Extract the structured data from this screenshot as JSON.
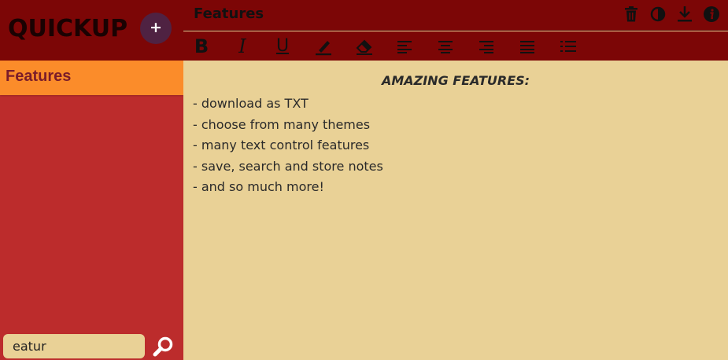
{
  "app": {
    "logo": "QUICKUP",
    "add_label": "+"
  },
  "sidebar": {
    "notes": [
      {
        "label": "Features"
      }
    ],
    "search": {
      "value": "eatur",
      "placeholder": ""
    }
  },
  "header": {
    "title": "Features"
  },
  "toolbar": {
    "actions": [
      "trash-icon",
      "theme-contrast-icon",
      "download-icon",
      "info-icon"
    ],
    "format": {
      "bold": "B",
      "italic": "I",
      "underline": "U",
      "highlight": "highlighter-icon",
      "eraser": "eraser-icon",
      "align_left": "align-left-icon",
      "align_center": "align-center-icon",
      "align_right": "align-right-icon",
      "justify": "align-justify-icon",
      "list": "bullet-list-icon"
    }
  },
  "editor": {
    "heading": "AMAZING FEATURES:",
    "lines": [
      "- download as TXT",
      "- choose from many themes",
      "- many text control features",
      "- save, search and store notes",
      "- and so much more!"
    ]
  },
  "colors": {
    "header_bg": "#7c0606",
    "sidebar_bg": "#bc2c2c",
    "active_note_bg": "#fb8c2a",
    "editor_bg": "#e9d196",
    "add_button_bg": "#4f2242"
  }
}
